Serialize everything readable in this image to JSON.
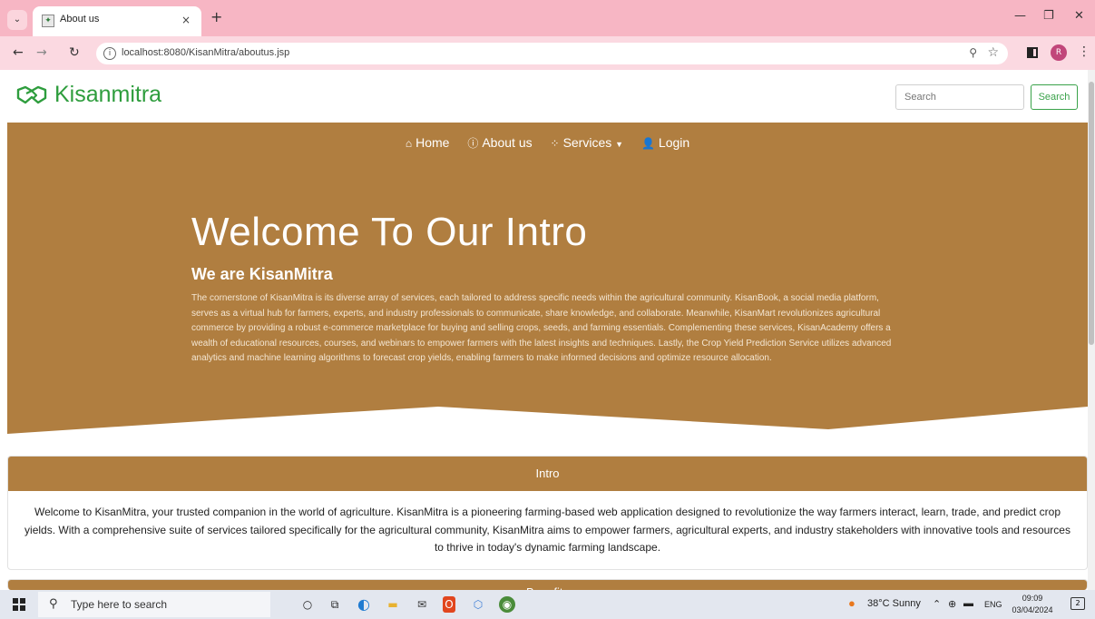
{
  "browser": {
    "tab_title": "About us",
    "tab_close": "×",
    "new_tab": "+",
    "url": "localhost:8080/KisanMitra/aboutus.jsp"
  },
  "site": {
    "brand": "Kisanmitra",
    "search_placeholder": "Search",
    "search_button": "Search",
    "brand_color": "#2e9d3d",
    "accent_color": "#b07e40"
  },
  "nav": {
    "items": [
      {
        "label": "Home",
        "icon": "home-icon"
      },
      {
        "label": "About us",
        "icon": "info-icon"
      },
      {
        "label": "Services",
        "icon": "spinner-icon"
      },
      {
        "label": "Login",
        "icon": "user-plus-icon"
      }
    ]
  },
  "hero": {
    "title": "Welcome To Our Intro",
    "subtitle": "We are KisanMitra",
    "text": "The cornerstone of KisanMitra is its diverse array of services, each tailored to address specific needs within the agricultural community. KisanBook, a social media platform, serves as a virtual hub for farmers, experts, and industry professionals to communicate, share knowledge, and collaborate. Meanwhile, KisanMart revolutionizes agricultural commerce by providing a robust e-commerce marketplace for buying and selling crops, seeds, and farming essentials. Complementing these services, KisanAcademy offers a wealth of educational resources, courses, and webinars to empower farmers with the latest insights and techniques. Lastly, the Crop Yield Prediction Service utilizes advanced analytics and machine learning algorithms to forecast crop yields, enabling farmers to make informed decisions and optimize resource allocation."
  },
  "intro": {
    "heading": "Intro",
    "body": "Welcome to KisanMitra, your trusted companion in the world of agriculture. KisanMitra is a pioneering farming-based web application designed to revolutionize the way farmers interact, learn, trade, and predict crop yields. With a comprehensive suite of services tailored specifically for the agricultural community, KisanMitra aims to empower farmers, agricultural experts, and industry stakeholders with innovative tools and resources to thrive in today's dynamic farming landscape."
  },
  "benefits": {
    "heading": "Benefits"
  },
  "taskbar": {
    "search_placeholder": "Type here to search",
    "weather": "38°C Sunny",
    "language": "ENG",
    "time": "09:09",
    "date": "03/04/2024"
  }
}
